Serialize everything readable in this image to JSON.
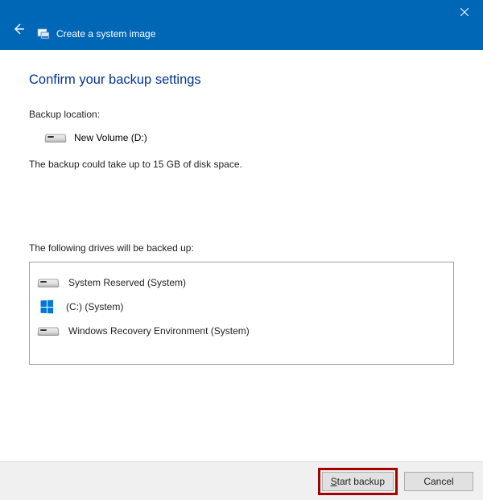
{
  "window": {
    "title": "Create a system image"
  },
  "page": {
    "heading": "Confirm your backup settings",
    "location_label": "Backup location:",
    "location_value": "New Volume (D:)",
    "size_note": "The backup could take up to 15 GB of disk space.",
    "drives_label": "The following drives will be backed up:",
    "drives": [
      {
        "label": "System Reserved (System)",
        "icon": "hdd"
      },
      {
        "label": "(C:) (System)",
        "icon": "windows"
      },
      {
        "label": "Windows Recovery Environment (System)",
        "icon": "hdd"
      }
    ]
  },
  "footer": {
    "start_label": "Start backup",
    "cancel_label": "Cancel"
  }
}
